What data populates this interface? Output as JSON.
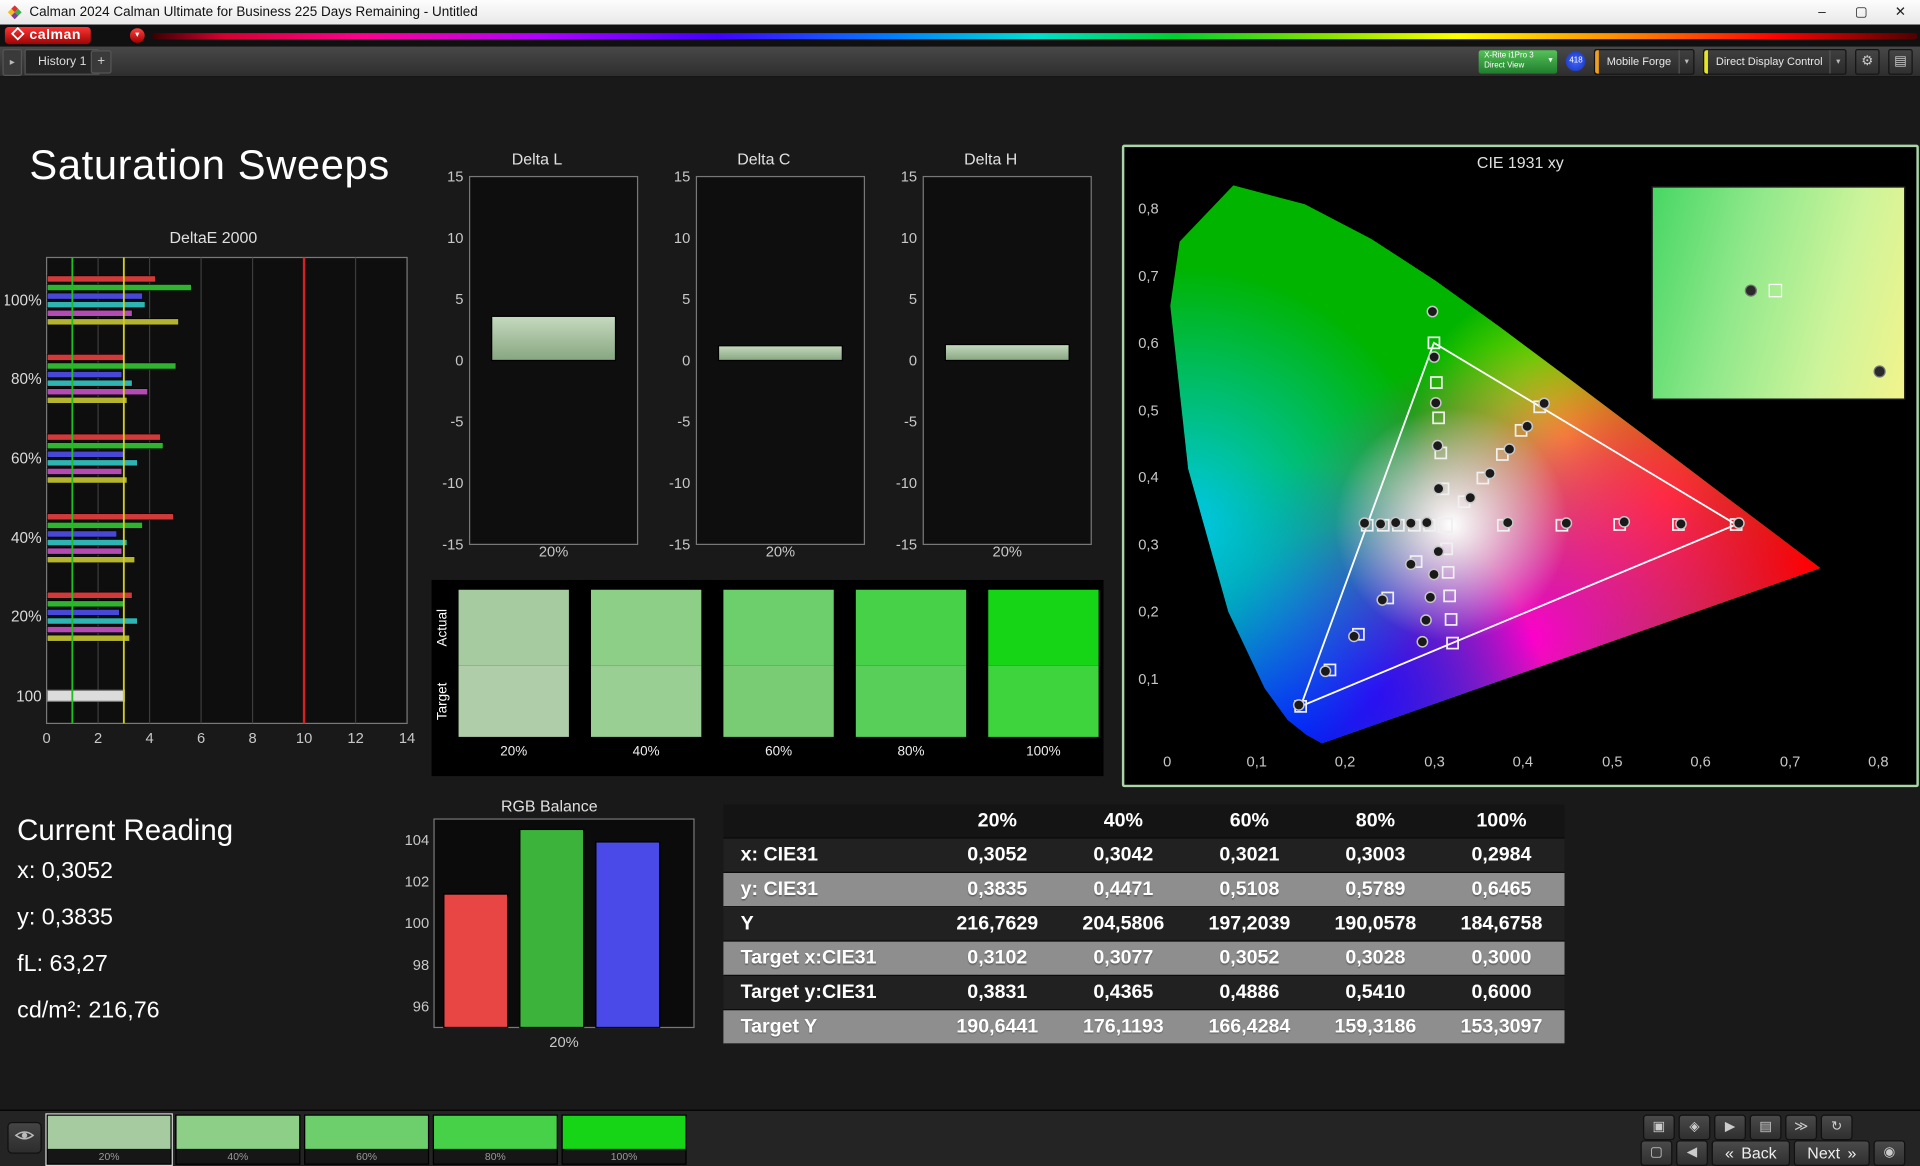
{
  "window": {
    "title": "Calman 2024 Calman Ultimate for Business 225 Days Remaining  - Untitled",
    "controls": {
      "minimize": "–",
      "maximize": "▢",
      "close": "✕"
    }
  },
  "brand": {
    "logo_text": "calman"
  },
  "icons": {
    "panel_arrow": "▸",
    "plus": "+",
    "caret_down": "▾",
    "gear": "⚙",
    "layout": "▤"
  },
  "toolbar": {
    "history_tab": "History 1",
    "meter_button": {
      "line1": "X-Rite i1Pro 3",
      "line2": "Direct View",
      "color": "#2fa83c"
    },
    "badge": {
      "text": "418",
      "color": "#2244cc"
    },
    "source_button": {
      "label": "Mobile Forge",
      "accent": "#f0a020"
    },
    "display_button": {
      "label": "Direct Display Control",
      "accent": "#e6e622"
    }
  },
  "page_title": "Saturation Sweeps",
  "deltae": {
    "title": "DeltaE 2000",
    "groups": [
      "100%",
      "80%",
      "60%",
      "40%",
      "20%"
    ],
    "series_colors": [
      "#d23a3a",
      "#2fb42f",
      "#4848d8",
      "#2fb4b4",
      "#b44ab4",
      "#b4b42f"
    ],
    "values": [
      [
        4.2,
        5.6,
        3.7,
        3.8,
        3.3,
        5.1
      ],
      [
        3.0,
        5.0,
        2.9,
        3.3,
        3.9,
        3.1
      ],
      [
        4.4,
        4.5,
        3.0,
        3.5,
        2.9,
        3.1
      ],
      [
        4.9,
        3.7,
        2.7,
        3.1,
        2.9,
        3.4
      ],
      [
        3.3,
        3.0,
        2.8,
        3.5,
        3.0,
        3.2
      ]
    ],
    "white_group_label": "100",
    "white_value": 3.0,
    "x_ticks": [
      0,
      2,
      4,
      6,
      8,
      10,
      12,
      14
    ],
    "xmax": 14,
    "ref_lines": {
      "green": 1,
      "yellow": 3,
      "red": 10
    },
    "ref_colors": {
      "green": "#1fbf1f",
      "yellow": "#cfcf20",
      "red": "#d42222"
    }
  },
  "delta_axis": {
    "ymin": -15,
    "ymax": 15,
    "ticks": [
      15,
      10,
      5,
      0,
      -5,
      -10,
      -15
    ]
  },
  "delta_charts": [
    {
      "title": "Delta L",
      "value": 3.6,
      "x_label": "20%"
    },
    {
      "title": "Delta C",
      "value": 1.2,
      "x_label": "20%"
    },
    {
      "title": "Delta H",
      "value": 1.3,
      "x_label": "20%"
    }
  ],
  "swatches": {
    "row_labels": [
      "Actual",
      "Target"
    ],
    "levels": [
      {
        "label": "20%",
        "actual": "#a6cba0",
        "target": "#b0cdaa"
      },
      {
        "label": "40%",
        "actual": "#8ecf88",
        "target": "#99cf92"
      },
      {
        "label": "60%",
        "actual": "#6ccf6c",
        "target": "#79cc74"
      },
      {
        "label": "80%",
        "actual": "#46d148",
        "target": "#58cf58"
      },
      {
        "label": "100%",
        "actual": "#16d416",
        "target": "#3ed43e"
      }
    ]
  },
  "cie": {
    "title": "CIE 1931 xy",
    "x_ticks": [
      "0",
      "0,1",
      "0,2",
      "0,3",
      "0,4",
      "0,5",
      "0,6",
      "0,7",
      "0,8"
    ],
    "y_ticks": [
      "0,8",
      "0,7",
      "0,6",
      "0,5",
      "0,4",
      "0,3",
      "0,2",
      "0,1"
    ],
    "gamut_triangle": [
      [
        0.64,
        0.33
      ],
      [
        0.3,
        0.6
      ],
      [
        0.15,
        0.06
      ]
    ],
    "targets": {
      "white": [
        0.3127,
        0.329
      ],
      "red": [
        [
          0.378,
          0.329
        ],
        [
          0.444,
          0.329
        ],
        [
          0.509,
          0.33
        ],
        [
          0.575,
          0.33
        ],
        [
          0.64,
          0.33
        ]
      ],
      "green": [
        [
          0.3102,
          0.3831
        ],
        [
          0.3077,
          0.4365
        ],
        [
          0.3052,
          0.4886
        ],
        [
          0.3028,
          0.541
        ],
        [
          0.3,
          0.6
        ]
      ],
      "blue": [
        [
          0.28,
          0.275
        ],
        [
          0.248,
          0.221
        ],
        [
          0.215,
          0.167
        ],
        [
          0.183,
          0.114
        ],
        [
          0.15,
          0.06
        ]
      ],
      "cyan": [
        [
          0.295,
          0.329
        ],
        [
          0.278,
          0.329
        ],
        [
          0.26,
          0.329
        ],
        [
          0.243,
          0.329
        ],
        [
          0.225,
          0.329
        ]
      ],
      "magenta": [
        [
          0.3144,
          0.294
        ],
        [
          0.316,
          0.259
        ],
        [
          0.3177,
          0.224
        ],
        [
          0.3193,
          0.189
        ],
        [
          0.3209,
          0.154
        ]
      ],
      "yellow": [
        [
          0.334,
          0.364
        ],
        [
          0.355,
          0.399
        ],
        [
          0.377,
          0.434
        ],
        [
          0.398,
          0.47
        ],
        [
          0.419,
          0.505
        ]
      ]
    },
    "measurements": {
      "green": [
        [
          0.3052,
          0.3835
        ],
        [
          0.3042,
          0.4471
        ],
        [
          0.3021,
          0.5108
        ],
        [
          0.3003,
          0.5789
        ],
        [
          0.2984,
          0.6465
        ]
      ],
      "red": [
        [
          0.383,
          0.333
        ],
        [
          0.449,
          0.332
        ],
        [
          0.514,
          0.334
        ],
        [
          0.578,
          0.331
        ],
        [
          0.643,
          0.332
        ]
      ],
      "cyan": [
        [
          0.292,
          0.333
        ],
        [
          0.274,
          0.332
        ],
        [
          0.257,
          0.333
        ],
        [
          0.24,
          0.331
        ],
        [
          0.222,
          0.332
        ]
      ],
      "blue": [
        [
          0.274,
          0.271
        ],
        [
          0.242,
          0.218
        ],
        [
          0.21,
          0.164
        ],
        [
          0.178,
          0.112
        ],
        [
          0.148,
          0.062
        ]
      ],
      "magenta": [
        [
          0.305,
          0.29
        ],
        [
          0.3,
          0.256
        ],
        [
          0.296,
          0.222
        ],
        [
          0.291,
          0.188
        ],
        [
          0.287,
          0.156
        ]
      ],
      "yellow": [
        [
          0.341,
          0.37
        ],
        [
          0.363,
          0.406
        ],
        [
          0.385,
          0.442
        ],
        [
          0.405,
          0.476
        ],
        [
          0.424,
          0.51
        ]
      ]
    },
    "inset": {
      "points": [
        {
          "shape": "circle",
          "fx": 0.39,
          "fy": 0.49
        },
        {
          "shape": "square",
          "fx": 0.49,
          "fy": 0.49
        },
        {
          "shape": "circle",
          "fx": 0.9,
          "fy": 0.87
        }
      ]
    }
  },
  "current_reading": {
    "title": "Current Reading",
    "lines": [
      "x: 0,3052",
      "y: 0,3835",
      "fL: 63,27",
      "cd/m²: 216,76"
    ]
  },
  "rgb_balance": {
    "title": "RGB Balance",
    "x_label": "20%",
    "ymin": 95,
    "ymax": 105,
    "ticks": [
      104,
      102,
      100,
      98,
      96
    ],
    "bars": [
      {
        "name": "red",
        "value": 101.4,
        "color": "#e84545"
      },
      {
        "name": "green",
        "value": 104.5,
        "color": "#3cb43c"
      },
      {
        "name": "blue",
        "value": 103.9,
        "color": "#4a4ae8"
      }
    ]
  },
  "table": {
    "columns": [
      "20%",
      "40%",
      "60%",
      "80%",
      "100%"
    ],
    "rows": [
      {
        "label": "x: CIE31",
        "values": [
          "0,3052",
          "0,3042",
          "0,3021",
          "0,3003",
          "0,2984"
        ]
      },
      {
        "label": "y: CIE31",
        "values": [
          "0,3835",
          "0,4471",
          "0,5108",
          "0,5789",
          "0,6465"
        ]
      },
      {
        "label": "Y",
        "values": [
          "216,7629",
          "204,5806",
          "197,2039",
          "190,0578",
          "184,6758"
        ]
      },
      {
        "label": "Target x:CIE31",
        "values": [
          "0,3102",
          "0,3077",
          "0,3052",
          "0,3028",
          "0,3000"
        ]
      },
      {
        "label": "Target y:CIE31",
        "values": [
          "0,3831",
          "0,4365",
          "0,4886",
          "0,5410",
          "0,6000"
        ]
      },
      {
        "label": "Target Y",
        "values": [
          "190,6441",
          "176,1193",
          "166,4284",
          "159,3186",
          "153,3097"
        ]
      }
    ]
  },
  "bottom_bar": {
    "swatches": [
      {
        "label": "20%",
        "color": "#a6cba0",
        "selected": true
      },
      {
        "label": "40%",
        "color": "#8ecf88",
        "selected": false
      },
      {
        "label": "60%",
        "color": "#6ccf6c",
        "selected": false
      },
      {
        "label": "80%",
        "color": "#46d148",
        "selected": false
      },
      {
        "label": "100%",
        "color": "#16d416",
        "selected": false
      }
    ],
    "tool_buttons_row1": [
      {
        "name": "screenshot-button",
        "glyph": "▣"
      },
      {
        "name": "lock-button",
        "glyph": "◈"
      },
      {
        "name": "play-button",
        "glyph": "▶"
      },
      {
        "name": "cash-button",
        "glyph": "▤"
      },
      {
        "name": "skip-button",
        "glyph": "≫"
      },
      {
        "name": "refresh-button",
        "glyph": "↻"
      }
    ],
    "tool_buttons_row2": [
      {
        "name": "display-mode-button",
        "glyph": "▢"
      },
      {
        "name": "speaker-button",
        "glyph": "◀"
      }
    ],
    "back_icon": "«",
    "next_icon": "»",
    "power_glyph": "◉",
    "back_label": "Back",
    "next_label": "Next"
  }
}
